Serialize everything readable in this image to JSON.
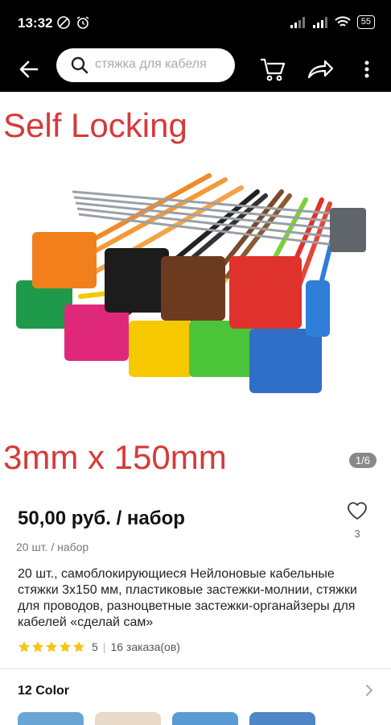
{
  "status_bar": {
    "time": "13:32",
    "battery": "55",
    "icons": [
      "do-not-disturb-icon",
      "alarm-icon",
      "signal-icon",
      "signal-icon",
      "wifi-icon",
      "battery-icon"
    ]
  },
  "top_bar": {
    "search_placeholder": "стяжка для кабеля",
    "icons": [
      "back-arrow-icon",
      "search-icon",
      "cart-icon",
      "share-icon",
      "more-vertical-icon"
    ]
  },
  "gallery": {
    "heading_text": "Self Locking",
    "caption_text": "3mm x 150mm",
    "page_indicator": "1/6",
    "accent_color": "#d63a3a"
  },
  "product": {
    "price": "50,00 руб. / набор",
    "unit": "20 шт. / набор",
    "title": "20 шт., самоблокирующиеся Нейлоновые кабельные стяжки 3х150 мм, пластиковые застежки-молнии, стяжки для проводов, разноцветные застежки-органайзеры для кабелей «сделай сам»",
    "wishlist_count": "3",
    "rating_value": "5",
    "orders": "16 заказа(ов)",
    "star_color": "#f5c518"
  },
  "variants": {
    "label": "12 Color",
    "swatch_colors": [
      "#6aa5d6",
      "#e8d9c8",
      "#5b9bd5",
      "#4f86c6"
    ]
  }
}
